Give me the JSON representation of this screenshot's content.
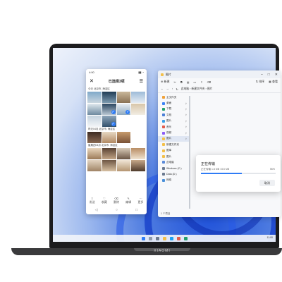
{
  "brand": "XIAOMI",
  "caption": "",
  "phone": {
    "status_time": "4:00",
    "status_right": "",
    "title": "已选择3项",
    "sections": [
      {
        "label": "今天  北京市, 海淀区"
      },
      {
        "label": "昨天04月  北京市, 海淀区"
      },
      {
        "label": "星期四04月  北京市, 海淀区"
      }
    ],
    "nav": [
      "发送",
      "收藏",
      "删除",
      "编辑",
      "更多"
    ]
  },
  "explorer": {
    "title": "图片",
    "toolbar": [
      "新建",
      "剪切",
      "复制",
      "粘贴",
      "重命名",
      "共享",
      "删除"
    ],
    "toolbar_right": [
      "排序",
      "查看"
    ],
    "address": [
      "此电脑",
      "新建文件夹",
      "图片"
    ],
    "sidebar": [
      {
        "label": "主文件夹",
        "icon": "home-icon",
        "color": "#f0a23a"
      },
      {
        "label": "桌面",
        "icon": "desktop-icon",
        "color": "#3b82f6"
      },
      {
        "label": "下载",
        "icon": "download-icon",
        "color": "#22a06b"
      },
      {
        "label": "文档",
        "icon": "document-icon",
        "color": "#4a7fd6"
      },
      {
        "label": "图片",
        "icon": "pictures-icon",
        "color": "#3aa0e6"
      },
      {
        "label": "音乐",
        "icon": "music-icon",
        "color": "#e25c4a"
      },
      {
        "label": "视频",
        "icon": "video-icon",
        "color": "#8b5cf6"
      },
      {
        "label": "图片",
        "icon": "folder-icon",
        "color": "#f3c04a"
      },
      {
        "label": "新建文件夹",
        "icon": "folder-icon",
        "color": "#f3c04a"
      },
      {
        "label": "图库",
        "icon": "folder-icon",
        "color": "#f3c04a"
      },
      {
        "label": "图片",
        "icon": "folder-icon",
        "color": "#f3c04a"
      },
      {
        "label": "此电脑",
        "icon": "pc-icon",
        "color": "#5b8bd9"
      },
      {
        "label": "Windows (C:)",
        "icon": "drive-icon",
        "color": "#6b7a90"
      },
      {
        "label": "Data (D:)",
        "icon": "drive-icon",
        "color": "#6b7a90"
      },
      {
        "label": "网络",
        "icon": "network-icon",
        "color": "#4a90d9"
      }
    ],
    "selected_index": 7,
    "status": "1 个项目"
  },
  "dialog": {
    "title": "正在传输",
    "detail": "正在传输 1.8 MB / 8.5 MB",
    "percent": "55%",
    "progress": 0.55,
    "cancel": "取消"
  },
  "taskbar": {
    "time": "11:00"
  }
}
